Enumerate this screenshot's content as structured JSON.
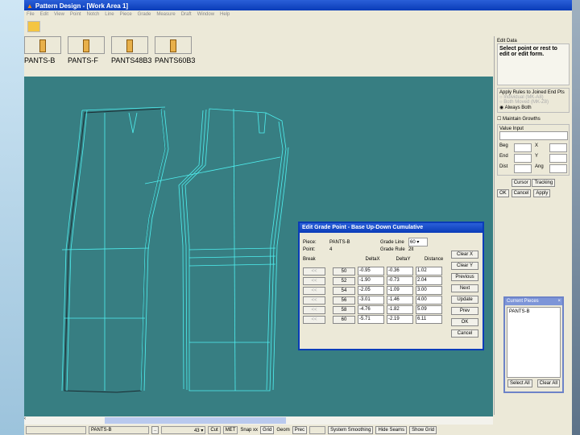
{
  "window": {
    "title": "Pattern Design - [Work Area 1]"
  },
  "menu": [
    "File",
    "Edit",
    "View",
    "Point",
    "Notch",
    "Line",
    "Piece",
    "Grade",
    "Measure",
    "Draft",
    "Window",
    "Help"
  ],
  "pieces": [
    "PANTS-B",
    "PANTS-F",
    "PANTS48B3",
    "PANTS60B3"
  ],
  "dialog": {
    "title": "Edit Grade Point - Base Up-Down Cumulative",
    "piece_label": "Piece:",
    "piece": "PANTS-B",
    "point_label": "Point:",
    "point": "4",
    "grade_line_label": "Grade Line",
    "grade_line": "60",
    "grade_rule_label": "Grade Rule",
    "grade_rule": "2lt",
    "break_label": "Break",
    "cols": [
      "DeltaX",
      "DeltaY",
      "Distance"
    ],
    "rows": [
      {
        "size": "50",
        "dx": "-0.95",
        "dy": "-0.36",
        "dist": "1.02"
      },
      {
        "size": "52",
        "dx": "-1.90",
        "dy": "-0.73",
        "dist": "2.04"
      },
      {
        "size": "54",
        "dx": "-2.05",
        "dy": "-1.09",
        "dist": "3.00"
      },
      {
        "size": "56",
        "dx": "-3.01",
        "dy": "-1.46",
        "dist": "4.00"
      },
      {
        "size": "58",
        "dx": "-4.76",
        "dy": "-1.82",
        "dist": "5.09"
      },
      {
        "size": "60",
        "dx": "-5.71",
        "dy": "-2.19",
        "dist": "6.11"
      }
    ],
    "brk": "<<",
    "buttons": [
      "Clear X",
      "Clear Y",
      "Previous",
      "Next",
      "Update",
      "Prev",
      "OK",
      "Cancel"
    ]
  },
  "right_panel": {
    "header": "Edit Data",
    "message": "Select point or rest to edit or edit form.",
    "apply_group": "Apply Rules to Joined End Pts",
    "options": [
      "Individual (MK-A8)",
      "Both Moved (MK-Z8)",
      "Always Both"
    ],
    "maintain": "Maintain Growths",
    "value_input": "Value Input",
    "labels": [
      "Beg",
      "End",
      "Dist",
      "X",
      "Y",
      "Ang"
    ],
    "cursor": "Cursor",
    "tracking": "Tracking",
    "ok": "OK",
    "cancel": "Cancel",
    "apply": "Apply"
  },
  "current_pieces": {
    "title": "Current Pieces",
    "items": [
      "PANTS-B"
    ],
    "select_all": "Select All",
    "clear_all": "Clear All"
  },
  "status": {
    "piece": "PANTS-B",
    "dots": "..",
    "size": "43",
    "cut": "Cut",
    "met": "MET",
    "snap": "Snap xx",
    "grid": "Grid",
    "geom": "Geom",
    "prec": "Prec",
    "smoothing": "System Smoothing",
    "hide_seams": "Hide Seams",
    "show_grid": "Show Grid"
  }
}
